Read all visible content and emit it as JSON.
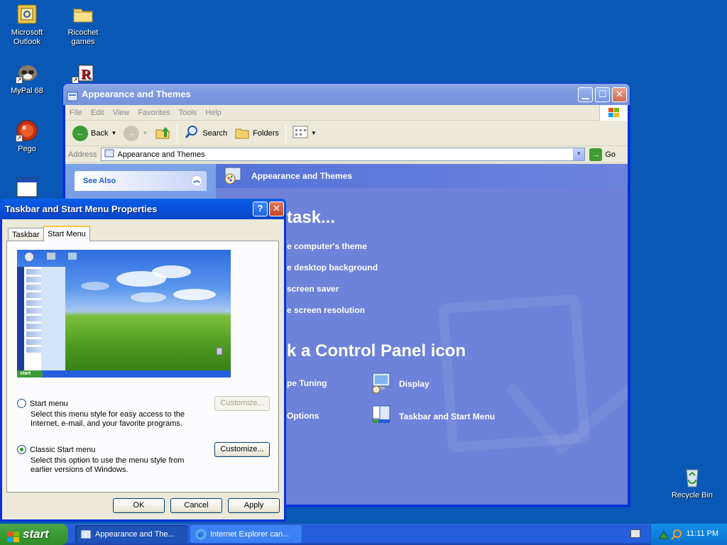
{
  "desktop": {
    "icons": [
      {
        "label_line1": "Microsoft",
        "label_line2": "Outlook"
      },
      {
        "label_line1": "Ricochet",
        "label_line2": "games"
      },
      {
        "label_line1": "MyPal 68",
        "label_line2": ""
      },
      {
        "label_line1": "Pego",
        "label_line2": ""
      }
    ],
    "recycle_bin": "Recycle Bin"
  },
  "explorer": {
    "title": "Appearance and Themes",
    "menu": [
      "File",
      "Edit",
      "View",
      "Favorites",
      "Tools",
      "Help"
    ],
    "toolbar": {
      "back": "Back",
      "search": "Search",
      "folders": "Folders"
    },
    "address_label": "Address",
    "address_value": "Appearance and Themes",
    "go": "Go",
    "see_also": "See Also",
    "header": "Appearance and Themes",
    "pick_task": "task...",
    "tasks": [
      "e computer's theme",
      "e desktop background",
      "screen saver",
      "e screen resolution"
    ],
    "pick_icon": "k a Control Panel icon",
    "cp_items": [
      "pe Tuning",
      "Display",
      "Options",
      "Taskbar and Start Menu"
    ]
  },
  "dialog": {
    "title": "Taskbar and Start Menu Properties",
    "help_btn": "?",
    "tabs": [
      "Taskbar",
      "Start Menu"
    ],
    "option_start": {
      "label": "Start menu",
      "desc_line1": "Select this menu style for easy access to the",
      "desc_line2": "Internet, e-mail, and your favorite programs.",
      "customize": "Customize...",
      "selected": false
    },
    "option_classic": {
      "label": "Classic Start menu",
      "desc_line1": "Select this option to use the menu style from",
      "desc_line2": "earlier versions of Windows.",
      "customize": "Customize...",
      "selected": true
    },
    "preview_start": "start",
    "buttons": {
      "ok": "OK",
      "cancel": "Cancel",
      "apply": "Apply"
    }
  },
  "taskbar": {
    "start": "start",
    "tasks": [
      {
        "label": "Appearance and The...",
        "active": true
      },
      {
        "label": "Internet Explorer can...",
        "active": false
      }
    ],
    "time": "11:11 PM"
  },
  "colors": {
    "desktop": "#0a58b5",
    "active_title": "#0a4bd2",
    "inactive_title": "#7d9adf",
    "start_green": "#3a9b35"
  }
}
